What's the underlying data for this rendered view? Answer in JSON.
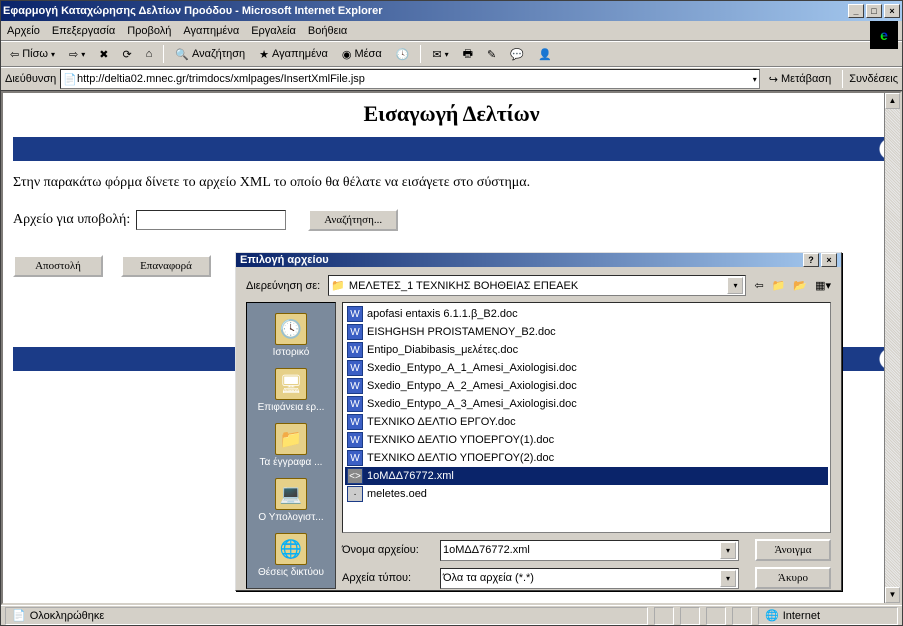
{
  "titlebar": {
    "title": "Εφαρμογή Καταχώρησης Δελτίων Προόδου - Microsoft Internet Explorer"
  },
  "menu": {
    "items": [
      "Αρχείο",
      "Επεξεργασία",
      "Προβολή",
      "Αγαπημένα",
      "Εργαλεία",
      "Βοήθεια"
    ]
  },
  "toolbar": {
    "back": "Πίσω",
    "search": "Αναζήτηση",
    "favorites": "Αγαπημένα",
    "media": "Μέσα"
  },
  "address": {
    "label": "Διεύθυνση",
    "url": "http://deltia02.mnec.gr/trimdocs/xmlpages/InsertXmlFile.jsp",
    "go": "Μετάβαση",
    "links": "Συνδέσεις"
  },
  "page": {
    "title": "Εισαγωγή Δελτίων",
    "instructions": "Στην παρακάτω φόρμα δίνετε το αρχείο XML το οποίο θα θέλατε να εισάγετε στο σύστημα.",
    "file_label": "Αρχείο για υποβολή:",
    "browse_btn": "Αναζήτηση...",
    "submit_btn": "Αποστολή",
    "reset_btn": "Επαναφορά"
  },
  "status": {
    "done": "Ολοκληρώθηκε",
    "zone": "Internet"
  },
  "dialog": {
    "title": "Επιλογή αρχείου",
    "look_in_label": "Διερεύνηση σε:",
    "look_in_value": "ΜΕΛΕΤΕΣ_1 ΤΕΧΝΙΚΗΣ ΒΟΗΘΕΙΑΣ ΕΠΕΑΕΚ",
    "places": [
      "Ιστορικό",
      "Επιφάνεια ερ...",
      "Τα έγγραφα ...",
      "Ο Υπολογιστ...",
      "Θέσεις δικτύου"
    ],
    "files": [
      {
        "name": "apofasi entaxis 6.1.1.β_B2.doc",
        "type": "doc",
        "selected": false
      },
      {
        "name": "EISHGHSH PROISTAMENOY_B2.doc",
        "type": "doc",
        "selected": false
      },
      {
        "name": "Entipo_Diabibasis_μελέτες.doc",
        "type": "doc",
        "selected": false
      },
      {
        "name": "Sxedio_Entypo_A_1_Amesi_Axiologisi.doc",
        "type": "doc",
        "selected": false
      },
      {
        "name": "Sxedio_Entypo_A_2_Amesi_Axiologisi.doc",
        "type": "doc",
        "selected": false
      },
      {
        "name": "Sxedio_Entypo_A_3_Amesi_Axiologisi.doc",
        "type": "doc",
        "selected": false
      },
      {
        "name": "ΤΕΧΝΙΚΟ ΔΕΛΤΙΟ ΕΡΓΟΥ.doc",
        "type": "doc",
        "selected": false
      },
      {
        "name": "ΤΕΧΝΙΚΟ ΔΕΛΤΙΟ ΥΠΟΕΡΓΟΥ(1).doc",
        "type": "doc",
        "selected": false
      },
      {
        "name": "ΤΕΧΝΙΚΟ ΔΕΛΤΙΟ ΥΠΟΕΡΓΟΥ(2).doc",
        "type": "doc",
        "selected": false
      },
      {
        "name": "1οΜΔΔ76772.xml",
        "type": "xml",
        "selected": true
      },
      {
        "name": "meletes.oed",
        "type": "oed",
        "selected": false
      }
    ],
    "filename_label": "Όνομα αρχείου:",
    "filename_value": "1οΜΔΔ76772.xml",
    "filetype_label": "Αρχεία τύπου:",
    "filetype_value": "Όλα τα αρχεία (*.*)",
    "open_btn": "Άνοιγμα",
    "cancel_btn": "Άκυρο"
  }
}
